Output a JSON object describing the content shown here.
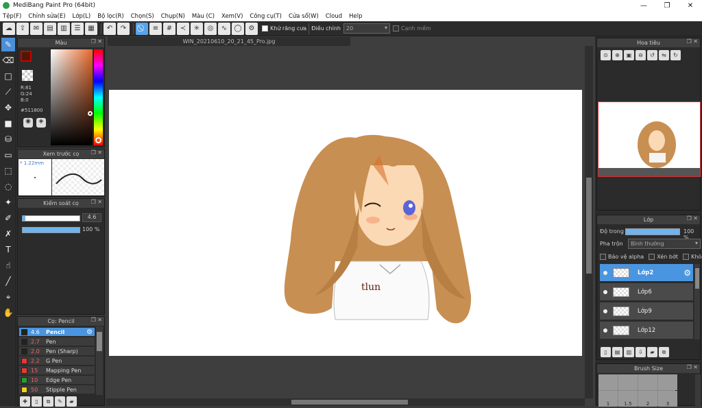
{
  "window": {
    "title": "MediBang Paint Pro (64bit)",
    "minimize": "—",
    "maximize": "❐",
    "close": "✕"
  },
  "menu": [
    "Tệp(F)",
    "Chỉnh sửa(E)",
    "Lớp(L)",
    "Bộ lọc(R)",
    "Chọn(S)",
    "Chụp(N)",
    "Màu (C)",
    "Xem(V)",
    "Công cụ(T)",
    "Cửa sổ(W)",
    "Cloud",
    "Help"
  ],
  "toolbar": {
    "antialias_label": "Khử răng cưa",
    "adjust_label": "Điều chỉnh",
    "adjust_value": "20",
    "soft_edge_label": "Cạnh mềm"
  },
  "color_panel": {
    "title": "Màu",
    "r": "R:81",
    "g": "G:24",
    "b": "B:0",
    "hex": "#511800",
    "fg_color": "#511800"
  },
  "preview_panel": {
    "title": "Xem trước cọ",
    "size": "* 1.22mm"
  },
  "brush_control": {
    "title": "Kiểm soát cọ",
    "size_value": "4.6",
    "opacity_value": "100 %",
    "opacity_fraction": 1.0,
    "size_fraction": 0.05
  },
  "brush_panel": {
    "title": "Cọ: Pencil",
    "items": [
      {
        "size": "4.6",
        "name": "Pencil",
        "color": "#222222"
      },
      {
        "size": "2.7",
        "name": "Pen",
        "color": "#222222"
      },
      {
        "size": "2.0",
        "name": "Pen (Sharp)",
        "color": "#222222"
      },
      {
        "size": "2.2",
        "name": "G Pen",
        "color": "#e53935"
      },
      {
        "size": "15",
        "name": "Mapping Pen",
        "color": "#e53935"
      },
      {
        "size": "10",
        "name": "Edge Pen",
        "color": "#2e9c2e"
      },
      {
        "size": "50",
        "name": "Stipple Pen",
        "color": "#f0d020"
      }
    ]
  },
  "document": {
    "tab": "WIN_20210610_20_21_45_Pro.jpg",
    "signature": "tlun"
  },
  "navigator": {
    "title": "Hoa tiêu"
  },
  "layers_panel": {
    "title": "Lớp",
    "opacity_label": "Độ trong",
    "opacity_value": "100 %",
    "opacity_fraction": 1.0,
    "blend_label": "Pha trộn",
    "blend_value": "Bình thường",
    "protect_alpha": "Bảo vệ alpha",
    "clip": "Xén bớt",
    "lock": "Khóa",
    "layers": [
      "Lớp2",
      "Lớp6",
      "Lớp9",
      "Lớp12"
    ]
  },
  "brush_size_panel": {
    "title": "Brush Size",
    "sizes": [
      "1",
      "1.5",
      "2",
      "3"
    ]
  }
}
